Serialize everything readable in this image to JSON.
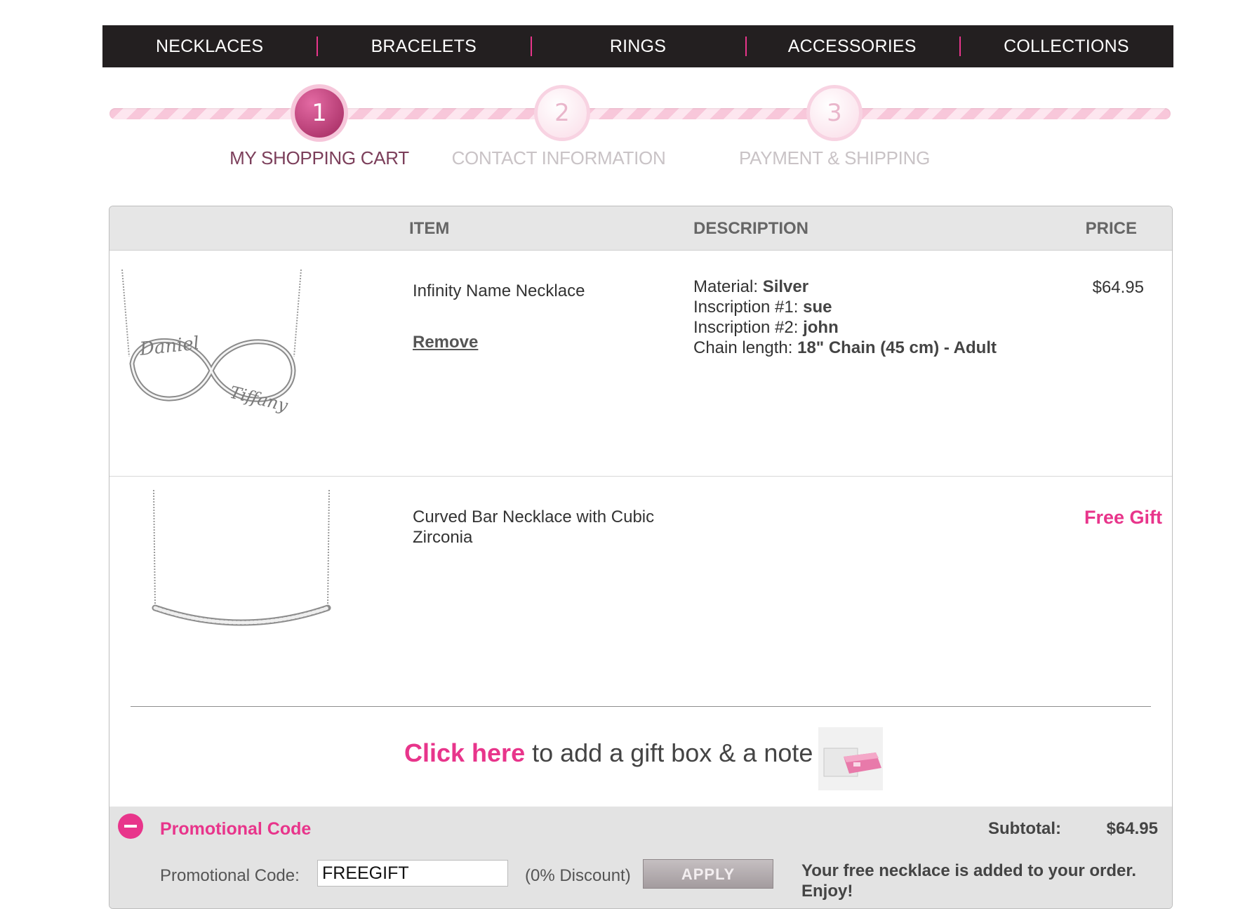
{
  "nav": {
    "items": [
      {
        "label": "NECKLACES"
      },
      {
        "label": "BRACELETS"
      },
      {
        "label": "RINGS"
      },
      {
        "label": "ACCESSORIES"
      },
      {
        "label": "COLLECTIONS"
      }
    ]
  },
  "steps": [
    {
      "number": "1",
      "label": "MY SHOPPING CART",
      "state": "active"
    },
    {
      "number": "2",
      "label": "CONTACT INFORMATION",
      "state": "inactive"
    },
    {
      "number": "3",
      "label": "PAYMENT & SHIPPING",
      "state": "inactive"
    }
  ],
  "table": {
    "headers": {
      "item": "ITEM",
      "description": "DESCRIPTION",
      "price": "PRICE"
    }
  },
  "items": [
    {
      "name": "Infinity Name Necklace",
      "remove_label": "Remove",
      "description": [
        {
          "label": "Material:",
          "value": "Silver"
        },
        {
          "label": "Inscription #1:",
          "value": "sue"
        },
        {
          "label": "Inscription #2:",
          "value": "john"
        },
        {
          "label": "Chain length:",
          "value": "18\" Chain (45 cm) - Adult"
        }
      ],
      "image_text": {
        "name1": "Daniel",
        "name2": "Tiffany"
      },
      "price": "$64.95"
    },
    {
      "name": "Curved Bar Necklace with Cubic Zirconia",
      "price": "Free Gift"
    }
  ],
  "giftbox": {
    "link_text": "Click here",
    "rest_text": " to add a gift box & a note"
  },
  "promo": {
    "title": "Promotional Code",
    "field_label": "Promotional Code:",
    "field_value": "FREEGIFT",
    "discount_text": "(0% Discount)",
    "apply_label": "APPLY"
  },
  "summary": {
    "subtotal_label": "Subtotal:",
    "subtotal_value": "$64.95",
    "message": "Your free necklace is added to your order. Enjoy!"
  },
  "colors": {
    "accent": "#e8358b",
    "nav_bg": "#231f20",
    "header_bg": "#e6e6e6"
  }
}
